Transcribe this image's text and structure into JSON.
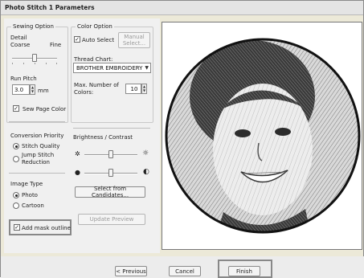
{
  "window": {
    "title": "Photo Stitch 1 Parameters"
  },
  "sewing_option": {
    "label": "Sewing Option",
    "detail_label": "Detail",
    "coarse": "Coarse",
    "fine": "Fine",
    "run_pitch_label": "Run Pitch",
    "run_pitch_value": "3.0",
    "run_pitch_unit": "mm",
    "sew_page_color": "Sew Page Color"
  },
  "conversion_priority": {
    "label": "Conversion Priority",
    "stitch_quality": "Stitch Quality",
    "jump_stitch": "Jump Stitch",
    "reduction": "Reduction"
  },
  "image_type": {
    "label": "Image Type",
    "photo": "Photo",
    "cartoon": "Cartoon"
  },
  "add_mask_outline": "Add mask outline",
  "color_option": {
    "label": "Color Option",
    "auto_select": "Auto Select",
    "manual_line1": "Manual",
    "manual_line2": "Select...",
    "thread_chart_label": "Thread Chart:",
    "thread_chart_value": "BROTHER EMBROIDERY",
    "max_colors_line1": "Max. Number of",
    "max_colors_line2": "Colors:",
    "max_colors_value": "10"
  },
  "brightness": {
    "label": "Brightness / Contrast",
    "select_candidates": "Select from Candidates..."
  },
  "update_preview": "Update Preview",
  "buttons": {
    "previous": "< Previous",
    "cancel": "Cancel",
    "finish": "Finish"
  },
  "states": {
    "auto_select_checked": true,
    "sew_page_color_checked": true,
    "add_mask_outline_checked": true,
    "conversion_priority": "Stitch Quality",
    "image_type": "Photo"
  },
  "colors": {
    "window_bg": "#ece9d8",
    "highlight_border": "#888888"
  }
}
